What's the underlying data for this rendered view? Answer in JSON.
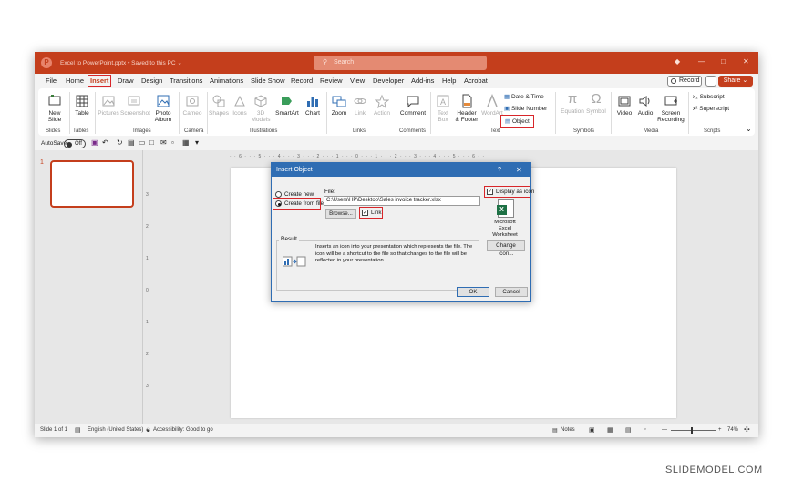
{
  "titlebar": {
    "document": "Excel to PowerPoint.pptx • Saved to this PC ⌄",
    "search_placeholder": "Search",
    "logo": "P"
  },
  "menu": {
    "tabs": [
      "File",
      "Home",
      "Insert",
      "Draw",
      "Design",
      "Transitions",
      "Animations",
      "Slide Show",
      "Record",
      "Review",
      "View",
      "Developer",
      "Add-ins",
      "Help",
      "Acrobat"
    ],
    "selected": "Insert",
    "record_label": "Record",
    "share_label": "Share ⌄"
  },
  "ribbon": {
    "new_slide": "New\nSlide",
    "table": "Table",
    "pictures": "Pictures",
    "screenshot": "Screenshot",
    "photo_album": "Photo\nAlbum",
    "cameo": "Cameo",
    "shapes": "Shapes",
    "icons": "Icons",
    "models_3d": "3D\nModels",
    "smartart": "SmartArt",
    "chart": "Chart",
    "zoom": "Zoom",
    "link": "Link",
    "action": "Action",
    "comment": "Comment",
    "text_box": "Text\nBox",
    "header_footer": "Header\n& Footer",
    "wordart": "WordArt",
    "date_time": "Date & Time",
    "slide_number": "Slide Number",
    "object": "Object",
    "equation": "Equation",
    "symbol": "Symbol",
    "video": "Video",
    "audio": "Audio",
    "screen_recording": "Screen\nRecording",
    "subscript": "Subscript",
    "superscript": "Superscript",
    "groups": {
      "slides": "Slides",
      "tables": "Tables",
      "images": "Images",
      "camera": "Camera",
      "illustrations": "Illustrations",
      "links": "Links",
      "comments": "Comments",
      "text": "Text",
      "symbols": "Symbols",
      "media": "Media",
      "scripts": "Scripts"
    }
  },
  "qat": {
    "autosave": "AutoSave",
    "toggle": "Off"
  },
  "ruler": {
    "h": "· · 6 · · · 5 · · · 4 · · · 3 · · · 2 · · · 1 · · · 0 · · · 1 · · · 2 · · · 3 · · · 4 · · · 5 · · · 6 · ·",
    "v": [
      "3",
      "2",
      "1",
      "0",
      "1",
      "2",
      "3"
    ]
  },
  "thumbnail_number": "1",
  "dialog": {
    "title": "Insert Object",
    "help": "?",
    "close": "✕",
    "create_new": "Create new",
    "create_from_file": "Create from file",
    "file_label": "File:",
    "file_path": "C:\\Users\\HP\\Desktop\\Sales invoice tracker.xlsx",
    "browse": "Browse...",
    "link": "Link",
    "display_as_icon": "Display as icon",
    "icon_caption": "Microsoft\nExcel\nWorksheet",
    "change_icon": "Change Icon...",
    "result_label": "Result",
    "result_text": "Inserts an icon into your presentation which represents the file. The icon will be a shortcut to the file so that changes to the file will be reflected in your presentation.",
    "ok": "OK",
    "cancel": "Cancel"
  },
  "status": {
    "slide": "Slide 1 of 1",
    "language": "English (United States)",
    "accessibility": "Accessibility: Good to go",
    "notes": "Notes",
    "zoom": "74%"
  },
  "watermark": "SLIDEMODEL.COM",
  "colors": {
    "accent": "#c43e1c",
    "highlight": "#d8262a",
    "dialog_title": "#2f6db3"
  }
}
